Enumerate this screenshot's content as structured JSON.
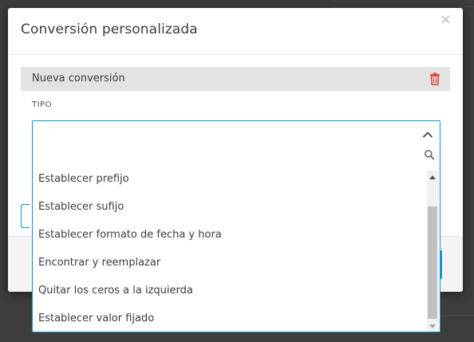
{
  "dialog": {
    "title": "Conversión personalizada",
    "close_symbol": "×"
  },
  "conversion": {
    "name": "Nueva conversión",
    "delete_icon": "trash-icon",
    "delete_color": "#e53935"
  },
  "tipo": {
    "label": "TIPO",
    "selected_value": ""
  },
  "dropdown": {
    "icons": [
      "chevron-up-icon",
      "search-icon"
    ],
    "accent_color": "#0696d7",
    "options": [
      "Establecer prefijo",
      "Establecer sufijo",
      "Establecer formato de fecha y hora",
      "Encontrar y reemplazar",
      "Quitar los ceros a la izquierda",
      "Establecer valor fijado"
    ]
  }
}
